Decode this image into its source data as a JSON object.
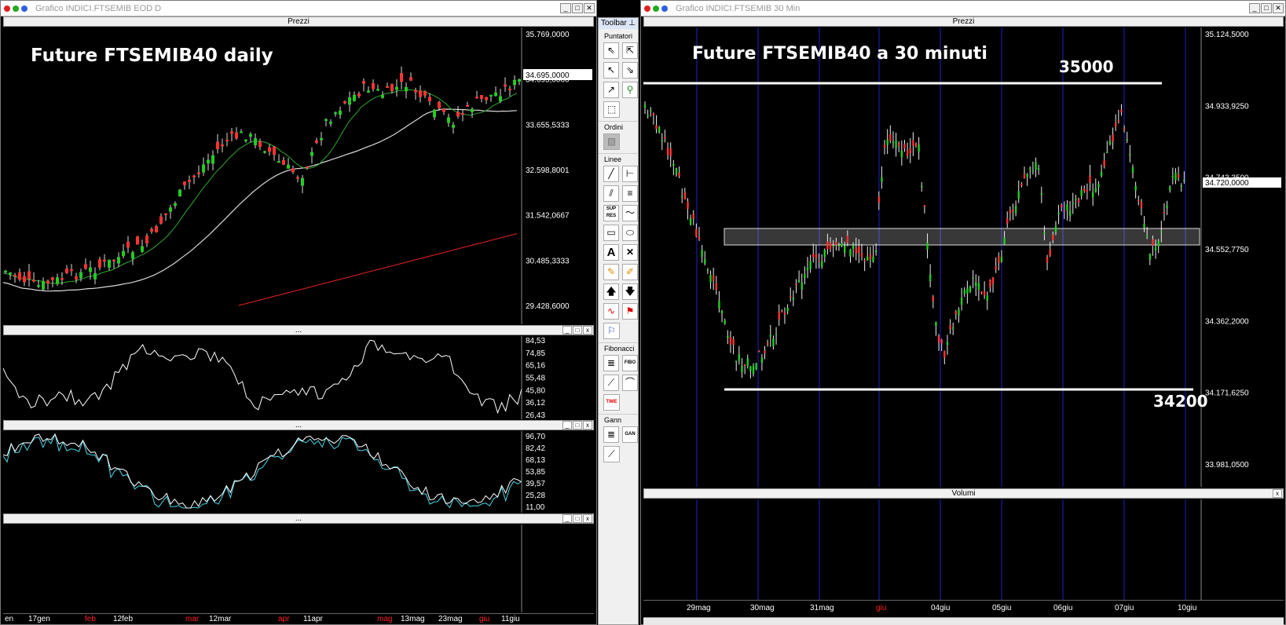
{
  "left_window": {
    "title": "Grafico INDICI.FTSEMIB EOD D",
    "price_pane_label": "Prezzi",
    "annotation": "Future FTSEMIB40 daily",
    "price_axis": [
      "35.769,0000",
      "34.695,0000",
      "33.655,5333",
      "32.598,8001",
      "31.542,0667",
      "30.485,3333",
      "29.428,6000"
    ],
    "osc1_axis": [
      "84,53",
      "74,85",
      "65,16",
      "55,48",
      "45,80",
      "36,12",
      "26,43"
    ],
    "osc2_axis": [
      "96,70",
      "82,42",
      "68,13",
      "53,85",
      "39,57",
      "25,28",
      "11,00"
    ],
    "pane_collapsed_label": "...",
    "x_labels": [
      {
        "text": "en",
        "red": false
      },
      {
        "text": "17gen",
        "red": false
      },
      {
        "text": "feb",
        "red": true
      },
      {
        "text": "12feb",
        "red": false
      },
      {
        "text": "mar",
        "red": true
      },
      {
        "text": "12mar",
        "red": false
      },
      {
        "text": "apr",
        "red": true
      },
      {
        "text": "11apr",
        "red": false
      },
      {
        "text": "mag",
        "red": true
      },
      {
        "text": "13mag",
        "red": false
      },
      {
        "text": "23mag",
        "red": false
      },
      {
        "text": "giu",
        "red": true
      },
      {
        "text": "11giu",
        "red": false
      }
    ]
  },
  "toolbar": {
    "title": "Toolbar",
    "sections": {
      "puntatori": "Puntatori",
      "ordini": "Ordini",
      "linee": "Linee",
      "fibonacci": "Fibonacci",
      "gann": "Gann"
    },
    "icons": {
      "sup_res": "SUP RES",
      "fibo": "FIBO",
      "time": "TIME",
      "gan": "GAN"
    }
  },
  "right_window": {
    "title": "Grafico INDICI.FTSEMIB 30 Min",
    "price_pane_label": "Prezzi",
    "volume_pane_label": "Volumi",
    "annotation": "Future FTSEMIB40 a 30 minuti",
    "level_high": "35000",
    "level_low": "34200",
    "price_axis": [
      "35.124,5000",
      "34.933,9250",
      "34.743,3500",
      "34.552,7750",
      "34.362,2000",
      "34.171,6250",
      "33.981,0500"
    ],
    "last_price": "34.720,0000",
    "x_labels": [
      {
        "text": "29mag",
        "red": false
      },
      {
        "text": "30mag",
        "red": false
      },
      {
        "text": "31mag",
        "red": false
      },
      {
        "text": "giu",
        "red": true
      },
      {
        "text": "04giu",
        "red": false
      },
      {
        "text": "05giu",
        "red": false
      },
      {
        "text": "06giu",
        "red": false
      },
      {
        "text": "07giu",
        "red": false
      },
      {
        "text": "10giu",
        "red": false
      }
    ]
  },
  "colors": {
    "bull": "#22cc22",
    "bear": "#ff3333",
    "ma_fast": "#2ea82e",
    "ma_slow": "#d8d8d8",
    "ma_long": "#cc1f1f",
    "session_line": "#2020c8",
    "osc_cyan": "#49d6e6"
  }
}
